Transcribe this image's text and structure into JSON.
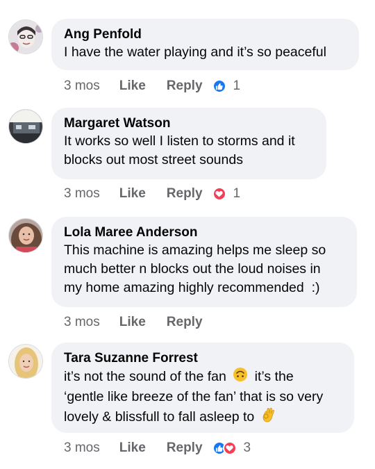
{
  "comments": [
    {
      "author": "Ang Penfold",
      "lines": [
        "I have the water playing and it’s so peaceful"
      ],
      "time": "3 mos",
      "like_label": "Like",
      "reply_label": "Reply",
      "reactions": [
        "like-icon"
      ],
      "reaction_count": "1"
    },
    {
      "author": "Margaret Watson",
      "lines": [
        "It works so well I listen to storms and it",
        "blocks out most street sounds"
      ],
      "time": "3 mos",
      "like_label": "Like",
      "reply_label": "Reply",
      "reactions": [
        "love-icon"
      ],
      "reaction_count": "1"
    },
    {
      "author": "Lola Maree Anderson",
      "lines": [
        "This machine is amazing helps me sleep so",
        "much better n blocks out the loud noises in",
        "my home amazing highly recommended  :)"
      ],
      "time": "3 mos",
      "like_label": "Like",
      "reply_label": "Reply"
    },
    {
      "author": "Tara Suzanne Forrest",
      "lines": [
        [
          "it’s not the sound of the fan",
          "it’s the"
        ],
        "‘gentle like breeze of the fan’ that is so very",
        "lovely & blissfull to fall asleep to"
      ],
      "time": "3 mos",
      "like_label": "Like",
      "reply_label": "Reply",
      "reactions": [
        "like-icon",
        "love-icon"
      ],
      "reaction_count": "3"
    }
  ],
  "colors": {
    "bubble": "#f0f2f5",
    "meta": "#65676b",
    "like_blue": "#1877f2",
    "love_red": "#f33e58"
  }
}
